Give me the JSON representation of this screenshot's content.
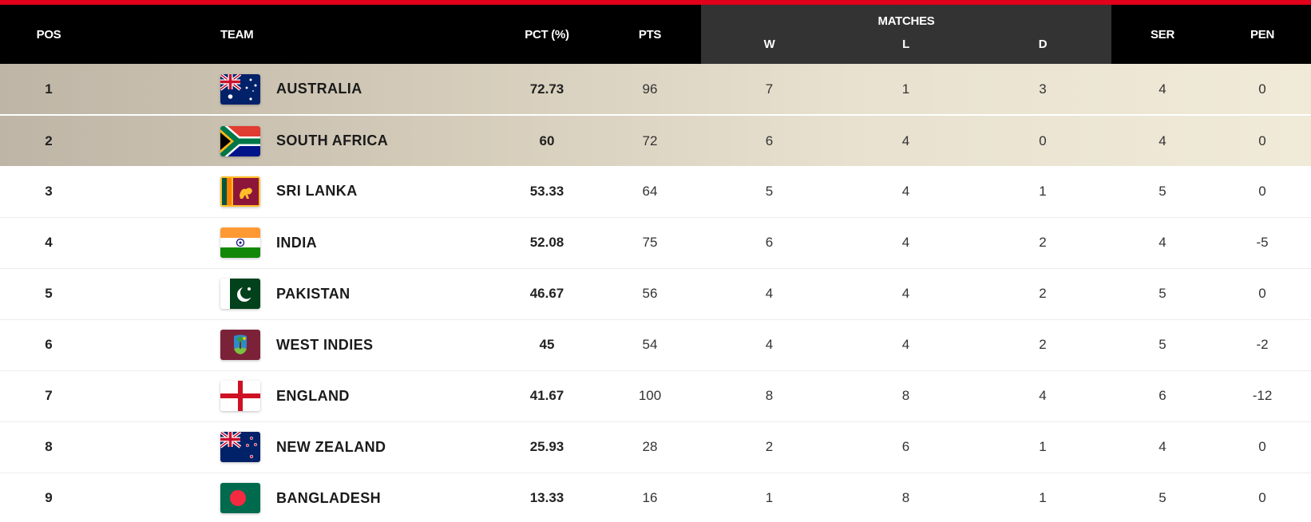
{
  "header": {
    "pos": "POS",
    "team": "TEAM",
    "pct": "PCT (%)",
    "pts": "PTS",
    "matches": "MATCHES",
    "w": "W",
    "l": "L",
    "d": "D",
    "ser": "SER",
    "pen": "PEN"
  },
  "colors": {
    "accent_bar": "#e0001b",
    "header_bg": "#000000",
    "matches_group_bg": "#333333",
    "highlight_row": "#d5ccba"
  },
  "rows": [
    {
      "pos": "1",
      "team": "AUSTRALIA",
      "flag": "australia-flag-icon",
      "pct": "72.73",
      "pts": "96",
      "w": "7",
      "l": "1",
      "d": "3",
      "ser": "4",
      "pen": "0",
      "highlight": true
    },
    {
      "pos": "2",
      "team": "SOUTH AFRICA",
      "flag": "south-africa-flag-icon",
      "pct": "60",
      "pts": "72",
      "w": "6",
      "l": "4",
      "d": "0",
      "ser": "4",
      "pen": "0",
      "highlight": true
    },
    {
      "pos": "3",
      "team": "SRI LANKA",
      "flag": "sri-lanka-flag-icon",
      "pct": "53.33",
      "pts": "64",
      "w": "5",
      "l": "4",
      "d": "1",
      "ser": "5",
      "pen": "0",
      "highlight": false
    },
    {
      "pos": "4",
      "team": "INDIA",
      "flag": "india-flag-icon",
      "pct": "52.08",
      "pts": "75",
      "w": "6",
      "l": "4",
      "d": "2",
      "ser": "4",
      "pen": "-5",
      "highlight": false
    },
    {
      "pos": "5",
      "team": "PAKISTAN",
      "flag": "pakistan-flag-icon",
      "pct": "46.67",
      "pts": "56",
      "w": "4",
      "l": "4",
      "d": "2",
      "ser": "5",
      "pen": "0",
      "highlight": false
    },
    {
      "pos": "6",
      "team": "WEST INDIES",
      "flag": "west-indies-flag-icon",
      "pct": "45",
      "pts": "54",
      "w": "4",
      "l": "4",
      "d": "2",
      "ser": "5",
      "pen": "-2",
      "highlight": false
    },
    {
      "pos": "7",
      "team": "ENGLAND",
      "flag": "england-flag-icon",
      "pct": "41.67",
      "pts": "100",
      "w": "8",
      "l": "8",
      "d": "4",
      "ser": "6",
      "pen": "-12",
      "highlight": false
    },
    {
      "pos": "8",
      "team": "NEW ZEALAND",
      "flag": "new-zealand-flag-icon",
      "pct": "25.93",
      "pts": "28",
      "w": "2",
      "l": "6",
      "d": "1",
      "ser": "4",
      "pen": "0",
      "highlight": false
    },
    {
      "pos": "9",
      "team": "BANGLADESH",
      "flag": "bangladesh-flag-icon",
      "pct": "13.33",
      "pts": "16",
      "w": "1",
      "l": "8",
      "d": "1",
      "ser": "5",
      "pen": "0",
      "highlight": false
    }
  ]
}
